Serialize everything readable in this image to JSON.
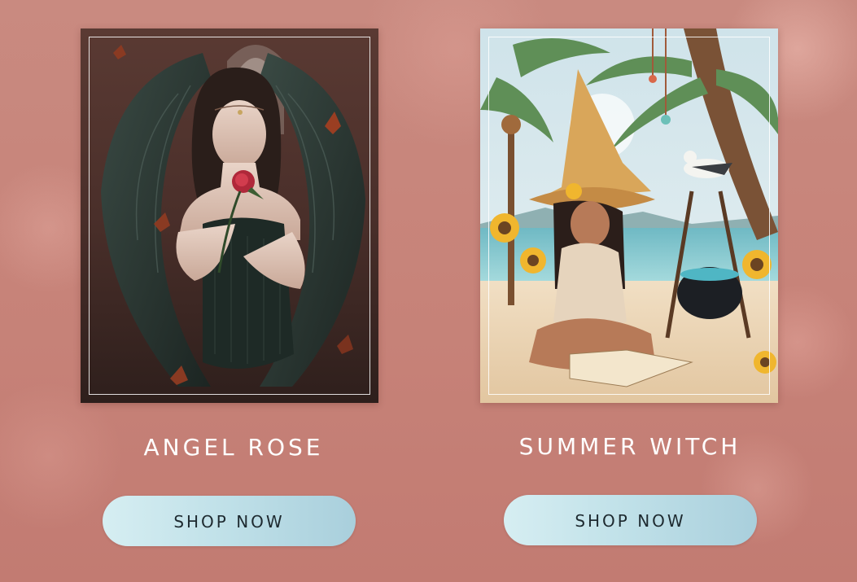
{
  "products": [
    {
      "title": "ANGEL ROSE",
      "button_label": "SHOP NOW"
    },
    {
      "title": "SUMMER WITCH",
      "button_label": "SHOP NOW"
    }
  ],
  "colors": {
    "background": "#c78379",
    "button_gradient_start": "#d6eef2",
    "button_gradient_end": "#a9cfdc",
    "title_text": "#ffffff",
    "button_text": "#1e2a30"
  }
}
